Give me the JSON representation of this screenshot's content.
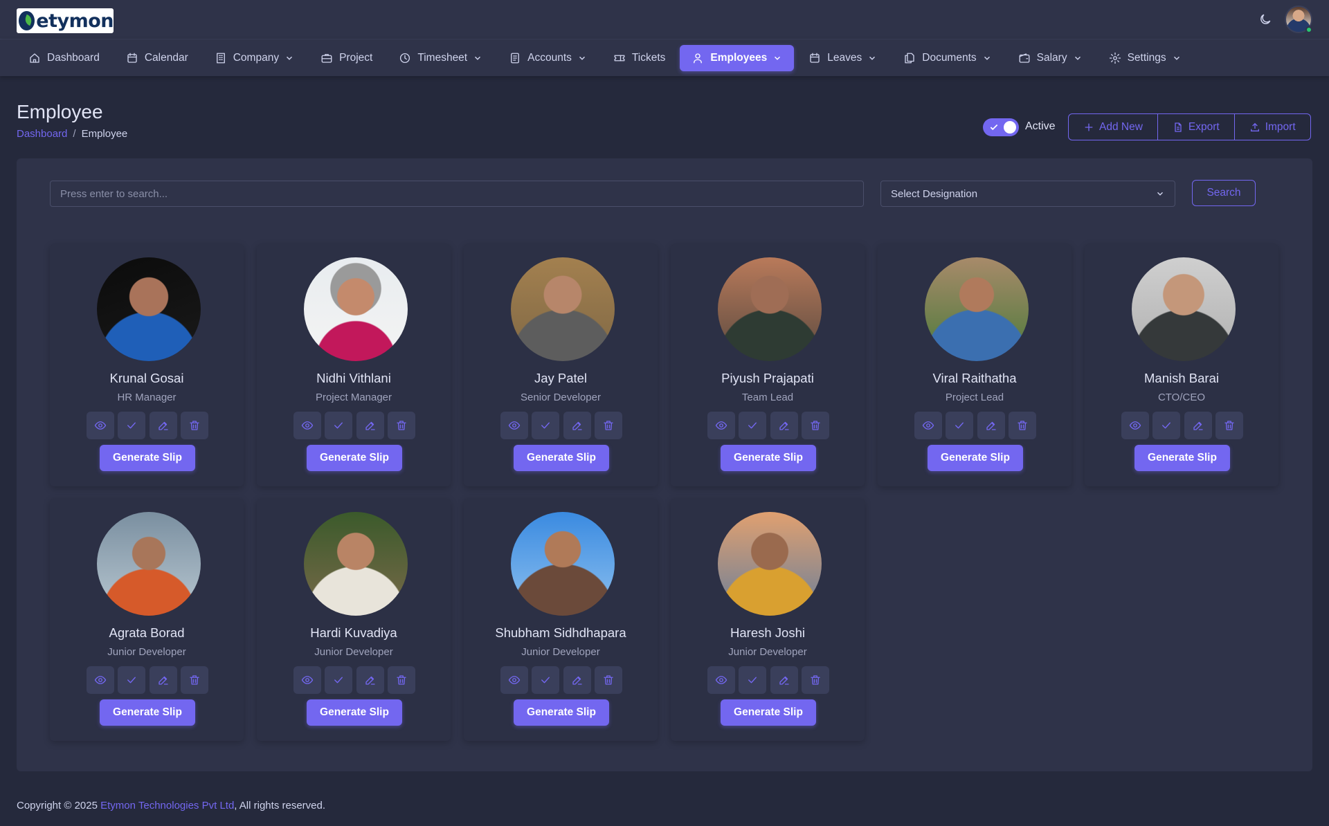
{
  "brand": {
    "name": "etymon"
  },
  "nav": [
    {
      "label": "Dashboard",
      "icon": "home-icon",
      "dropdown": false,
      "active": false
    },
    {
      "label": "Calendar",
      "icon": "calendar-icon",
      "dropdown": false,
      "active": false
    },
    {
      "label": "Company",
      "icon": "building-icon",
      "dropdown": true,
      "active": false
    },
    {
      "label": "Project",
      "icon": "briefcase-icon",
      "dropdown": false,
      "active": false
    },
    {
      "label": "Timesheet",
      "icon": "clock-icon",
      "dropdown": true,
      "active": false
    },
    {
      "label": "Accounts",
      "icon": "receipt-icon",
      "dropdown": true,
      "active": false
    },
    {
      "label": "Tickets",
      "icon": "ticket-icon",
      "dropdown": false,
      "active": false
    },
    {
      "label": "Employees",
      "icon": "user-icon",
      "dropdown": true,
      "active": true
    },
    {
      "label": "Leaves",
      "icon": "calendar-icon",
      "dropdown": true,
      "active": false
    },
    {
      "label": "Documents",
      "icon": "files-icon",
      "dropdown": true,
      "active": false
    },
    {
      "label": "Salary",
      "icon": "wallet-icon",
      "dropdown": true,
      "active": false
    },
    {
      "label": "Settings",
      "icon": "gear-icon",
      "dropdown": true,
      "active": false
    }
  ],
  "page": {
    "title": "Employee",
    "breadcrumb": {
      "parent": "Dashboard",
      "separator": "/",
      "current": "Employee"
    },
    "active_toggle": {
      "label": "Active",
      "on": true
    },
    "actions": {
      "add_new": "Add New",
      "export": "Export",
      "import": "Import"
    }
  },
  "filters": {
    "search_placeholder": "Press enter to search...",
    "designation_placeholder": "Select Designation",
    "search_button": "Search"
  },
  "employees": [
    {
      "name": "Krunal Gosai",
      "role": "HR Manager"
    },
    {
      "name": "Nidhi Vithlani",
      "role": "Project Manager"
    },
    {
      "name": "Jay Patel",
      "role": "Senior Developer"
    },
    {
      "name": "Piyush Prajapati",
      "role": "Team Lead"
    },
    {
      "name": "Viral Raithatha",
      "role": "Project Lead"
    },
    {
      "name": "Manish Barai",
      "role": "CTO/CEO"
    },
    {
      "name": "Agrata Borad",
      "role": "Junior Developer"
    },
    {
      "name": "Hardi Kuvadiya",
      "role": "Junior Developer"
    },
    {
      "name": "Shubham Sidhdhapara",
      "role": "Junior Developer"
    },
    {
      "name": "Haresh Joshi",
      "role": "Junior Developer"
    }
  ],
  "card_labels": {
    "generate_slip": "Generate Slip"
  },
  "footer": {
    "prefix": "Copyright © 2025 ",
    "company": "Etymon Technologies Pvt Ltd",
    "suffix": ", All rights reserved."
  },
  "colors": {
    "background": "#25293c",
    "surface": "#2f3349",
    "primary": "#7367f0",
    "text": "#cfd3ec",
    "online": "#28c76f"
  }
}
